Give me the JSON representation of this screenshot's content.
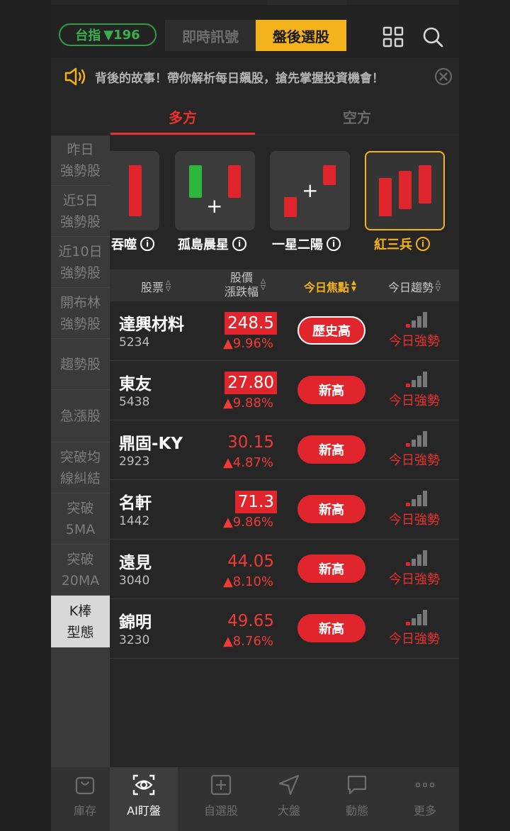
{
  "header": {
    "index_label": "台指",
    "index_change": "▼196",
    "tabs": [
      {
        "label": "即時訊號",
        "active": false
      },
      {
        "label": "盤後選股",
        "active": true
      }
    ],
    "grid_icon": "grid-icon",
    "search_icon": "search-icon"
  },
  "marquee": {
    "text": "背後的故事！帶你解析每日飆股，搶先掌握投資機會！",
    "speaker_icon": "speaker-icon",
    "close_icon": "close-icon"
  },
  "tabs": {
    "long": "多方",
    "short": "空方"
  },
  "left_nav": {
    "items": [
      {
        "label": "昨日\n強勢股"
      },
      {
        "label": "近5日\n強勢股"
      },
      {
        "label": "近10日\n強勢股"
      },
      {
        "label": "開布林\n強勢股"
      },
      {
        "label": "趨勢股"
      },
      {
        "label": "急漲股"
      },
      {
        "label": "突破均\n線糾結"
      },
      {
        "label": "突破\n5MA"
      },
      {
        "label": "突破\n20MA"
      },
      {
        "label": "K棒\n型態",
        "active": true
      }
    ]
  },
  "patterns": {
    "items": [
      {
        "label": "吞噬"
      },
      {
        "label": "孤島晨星"
      },
      {
        "label": "一星二陽"
      },
      {
        "label": "紅三兵",
        "selected": true
      }
    ],
    "info_glyph": "i"
  },
  "table": {
    "headers": {
      "stock": "股票",
      "price_line1": "股價",
      "price_line2": "漲跌幅",
      "focus": "今日焦點",
      "trend": "今日趨勢"
    },
    "rows": [
      {
        "name": "達興材料",
        "code": "5234",
        "price": "248.5",
        "price_boxed": true,
        "change": "▲9.96%",
        "badge": "歷史高",
        "trend": "今日強勢"
      },
      {
        "name": "東友",
        "code": "5438",
        "price": "27.80",
        "price_boxed": true,
        "change": "▲9.88%",
        "badge": "新高",
        "trend": "今日強勢"
      },
      {
        "name": "鼎固-KY",
        "code": "2923",
        "price": "30.15",
        "price_boxed": false,
        "change": "▲4.87%",
        "badge": "新高",
        "trend": "今日強勢"
      },
      {
        "name": "名軒",
        "code": "1442",
        "price": "71.3",
        "price_boxed": true,
        "change": "▲9.86%",
        "badge": "新高",
        "trend": "今日強勢"
      },
      {
        "name": "遠見",
        "code": "3040",
        "price": "44.05",
        "price_boxed": false,
        "change": "▲8.10%",
        "badge": "新高",
        "trend": "今日強勢"
      },
      {
        "name": "錦明",
        "code": "3230",
        "price": "49.65",
        "price_boxed": false,
        "change": "▲8.76%",
        "badge": "新高",
        "trend": "今日強勢"
      }
    ]
  },
  "bottom_nav": {
    "items": [
      {
        "label": "庫存",
        "icon": "bag-icon"
      },
      {
        "label": "AI盯盤",
        "icon": "eye-scan-icon",
        "active": true
      },
      {
        "label": "自選股",
        "icon": "plus-square-icon"
      },
      {
        "label": "大盤",
        "icon": "navigation-arrow-icon"
      },
      {
        "label": "動態",
        "icon": "chat-bubble-icon"
      },
      {
        "label": "更多",
        "icon": "more-dots-icon"
      }
    ]
  },
  "colors": {
    "up_red": "#e0262c",
    "accent_gold": "#f4b31a",
    "down_green": "#39b04a"
  }
}
